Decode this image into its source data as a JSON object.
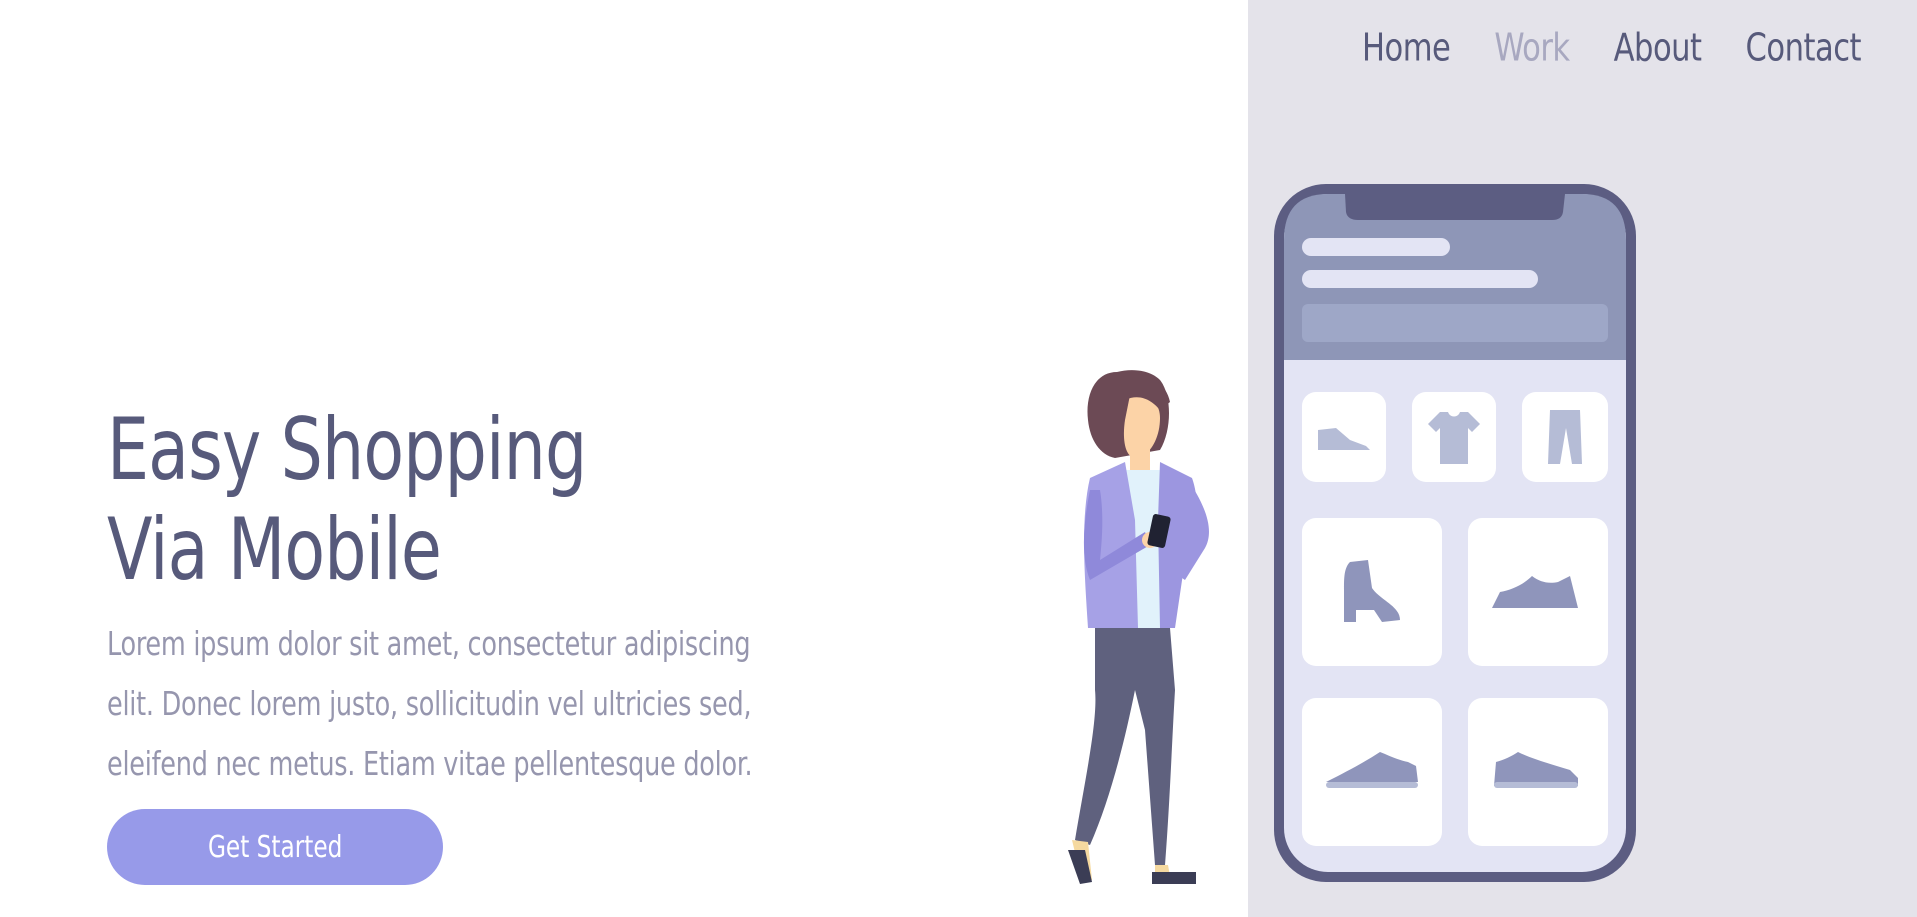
{
  "nav": {
    "items": [
      {
        "label": "Home"
      },
      {
        "label": "Work"
      },
      {
        "label": "About"
      },
      {
        "label": "Contact"
      }
    ]
  },
  "hero": {
    "title_line1": "Easy Shopping",
    "title_line2": "Via Mobile",
    "description": "Lorem ipsum dolor sit amet, consectetur adipiscing elit. Donec lorem justo, sollicitudin vel ultricies sed, eleifend nec metus. Etiam vitae pellentesque dolor.",
    "cta_label": "Get Started"
  },
  "phone": {
    "product_tiles": [
      "shoe-icon",
      "tshirt-icon",
      "pants-icon",
      "boot-icon",
      "sneaker-icon",
      "sneaker-icon",
      "sneaker-icon"
    ]
  },
  "colors": {
    "primary_text": "#575a7b",
    "muted_text": "#9696ae",
    "accent": "#979ae9",
    "panel_bg": "#e4e3ea",
    "active_nav": "#a8a8c0"
  }
}
